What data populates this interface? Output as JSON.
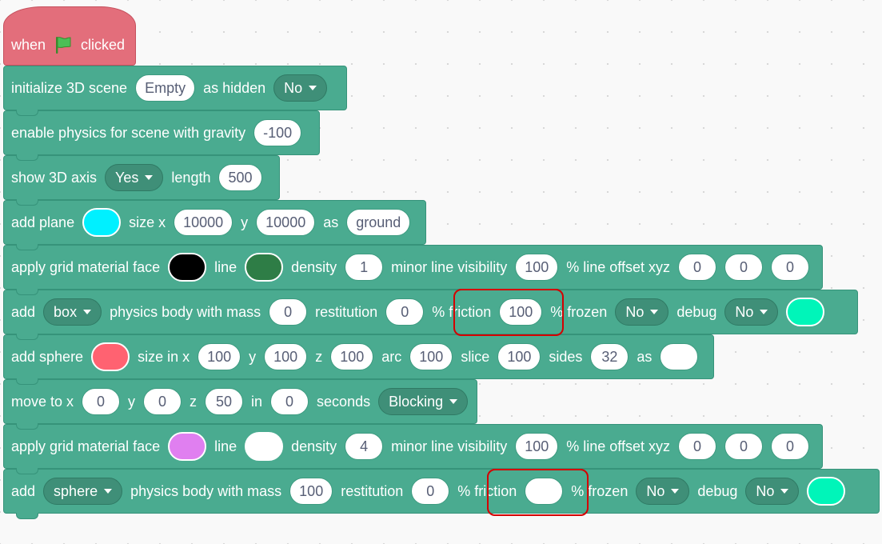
{
  "hat": {
    "when": "when",
    "clicked": "clicked",
    "flag_icon": "green-flag-icon"
  },
  "colors": {
    "hat": "#e36e7b",
    "block": "#4aab90",
    "plane": "#00f0ff",
    "grid_face_1": "#000000",
    "grid_line_1": "#2e7d46",
    "box_debug": "#00f5b9",
    "sphere": "#ff6271",
    "sphere_as": "#ffffff",
    "grid_face_2": "#e07ff0",
    "grid_line_2": "#ffffff",
    "sphere_debug": "#00f5b9",
    "highlight": "#d40000"
  },
  "blocks": {
    "init": {
      "t1": "initialize 3D scene",
      "scene": "Empty",
      "t2": "as hidden",
      "hidden": "No"
    },
    "physics": {
      "t1": "enable physics for scene with gravity",
      "gravity": "-100"
    },
    "axis": {
      "t1": "show 3D axis",
      "show": "Yes",
      "t2": "length",
      "length": "500"
    },
    "plane": {
      "t1": "add plane",
      "t2": "size x",
      "x": "10000",
      "t3": "y",
      "y": "10000",
      "t4": "as",
      "name": "ground"
    },
    "grid1": {
      "t1": "apply grid material face",
      "t2": "line",
      "t3": "density",
      "density": "1",
      "t4": "minor line visibility",
      "visibility": "100",
      "t5": "% line offset xyz",
      "ox": "0",
      "oy": "0",
      "oz": "0"
    },
    "body1": {
      "t1": "add",
      "shape": "box",
      "t2": "physics body with mass",
      "mass": "0",
      "t3": "restitution",
      "restitution": "0",
      "t4": "% friction",
      "friction": "100",
      "t5": "% frozen",
      "frozen": "No",
      "t6": "debug",
      "debug": "No"
    },
    "sphere": {
      "t1": "add sphere",
      "t2": "size in x",
      "x": "100",
      "t3": "y",
      "y": "100",
      "t4": "z",
      "z": "100",
      "t5": "arc",
      "arc": "100",
      "t6": "slice",
      "slice": "100",
      "t7": "sides",
      "sides": "32",
      "t8": "as"
    },
    "move": {
      "t1": "move to x",
      "x": "0",
      "t2": "y",
      "y": "0",
      "t3": "z",
      "z": "50",
      "t4": "in",
      "secs": "0",
      "t5": "seconds",
      "mode": "Blocking"
    },
    "grid2": {
      "t1": "apply grid material face",
      "t2": "line",
      "t3": "density",
      "density": "4",
      "t4": "minor line visibility",
      "visibility": "100",
      "t5": "% line offset xyz",
      "ox": "0",
      "oy": "0",
      "oz": "0"
    },
    "body2": {
      "t1": "add",
      "shape": "sphere",
      "t2": "physics body with mass",
      "mass": "100",
      "t3": "restitution",
      "restitution": "0",
      "t4": "% friction",
      "friction": "",
      "t5": "% frozen",
      "frozen": "No",
      "t6": "debug",
      "debug": "No"
    }
  }
}
